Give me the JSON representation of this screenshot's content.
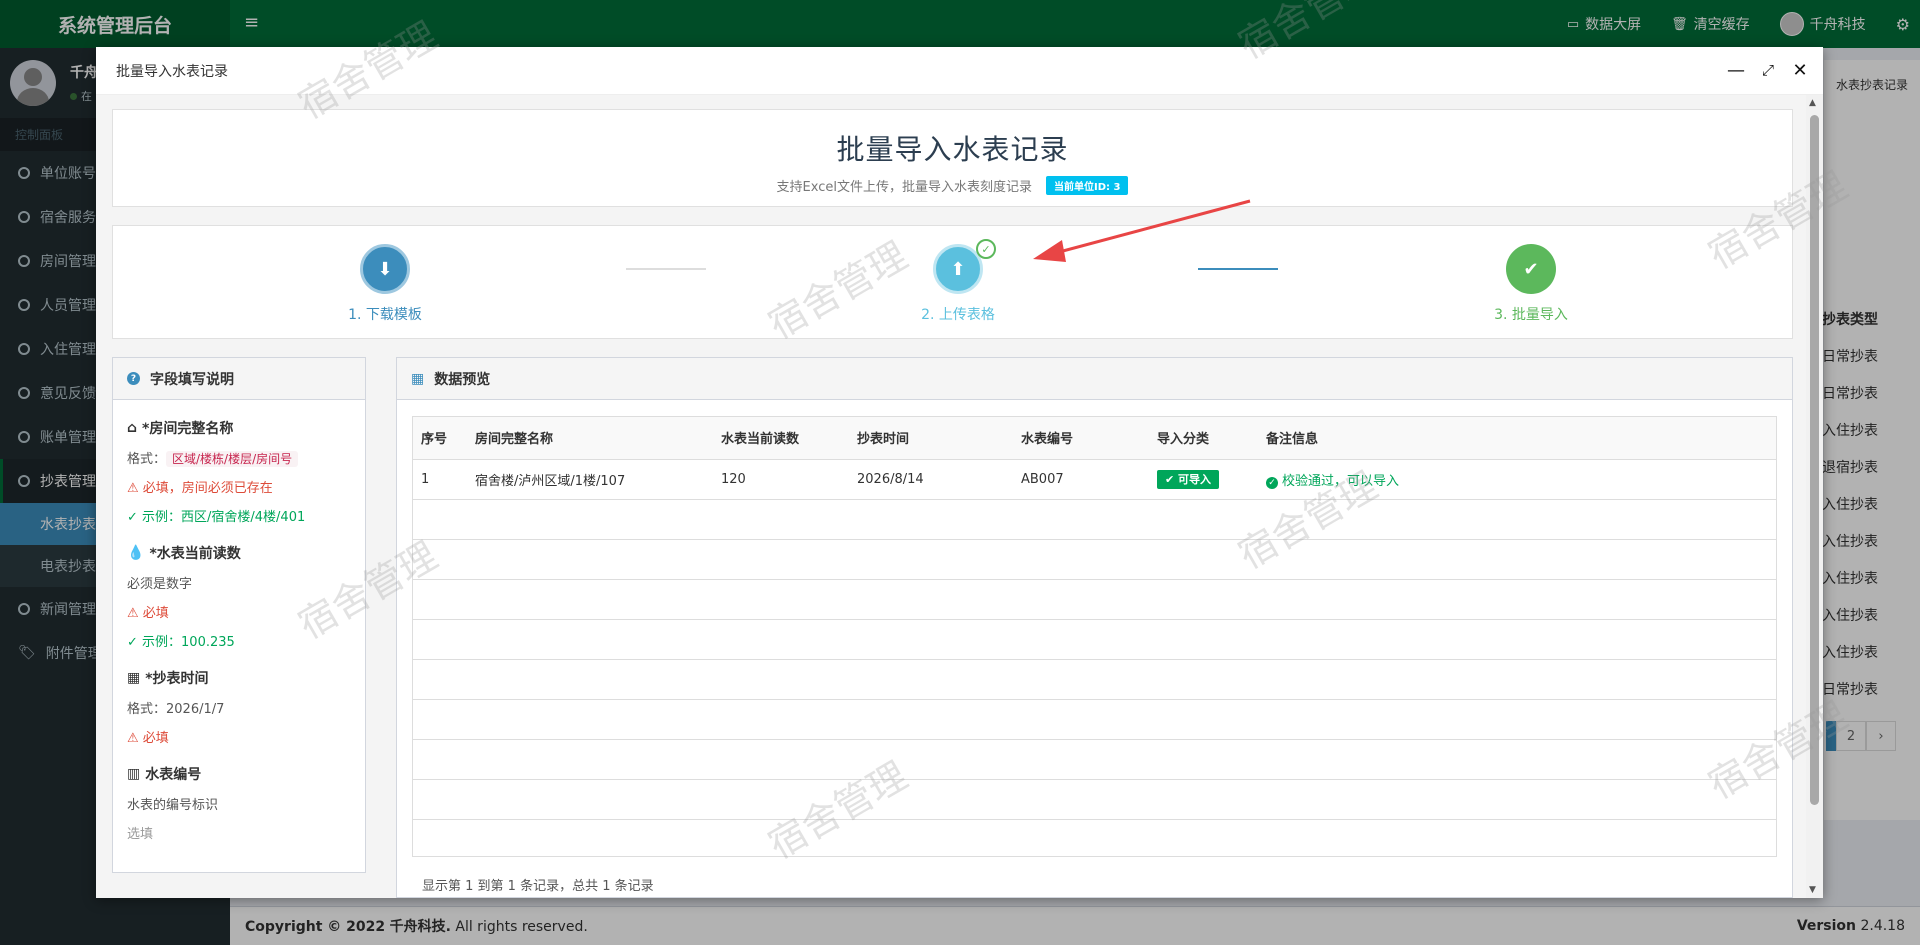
{
  "app": {
    "brand": "系统管理后台",
    "top_nav": {
      "data_screen": "数据大屏",
      "clear_cache": "清空缓存",
      "user": "千舟科技"
    },
    "user_panel": {
      "name": "千舟",
      "status": "在"
    },
    "menu_header": "控制面板",
    "menu": [
      {
        "label": "单位账号"
      },
      {
        "label": "宿舍服务"
      },
      {
        "label": "房间管理"
      },
      {
        "label": "人员管理"
      },
      {
        "label": "入住管理"
      },
      {
        "label": "意见反馈"
      },
      {
        "label": "账单管理"
      },
      {
        "label": "抄表管理"
      },
      {
        "label": "水表抄表"
      },
      {
        "label": "电表抄表"
      },
      {
        "label": "新闻管理"
      },
      {
        "label": "附件管理"
      }
    ],
    "footer": {
      "copyright_prefix": "Copyright © 2022",
      "company": "千舟科技.",
      "rights": "All rights reserved.",
      "version_label": "Version",
      "version": "2.4.18"
    },
    "bg_tab": "水表抄表记录",
    "bg_column": {
      "header": "抄表类型",
      "cells": [
        "日常抄表",
        "日常抄表",
        "入住抄表",
        "退宿抄表",
        "入住抄表",
        "入住抄表",
        "入住抄表",
        "入住抄表",
        "入住抄表",
        "日常抄表"
      ]
    },
    "bg_pager": {
      "page2": "2",
      "next": "›"
    }
  },
  "modal": {
    "title": "批量导入水表记录",
    "header": {
      "title": "批量导入水表记录",
      "subtitle": "支持Excel文件上传，批量导入水表刻度记录",
      "unit_badge": "当前单位ID: 3"
    },
    "steps": [
      {
        "label": "1. 下载模板",
        "color": "#3c8dbc"
      },
      {
        "label": "2. 上传表格",
        "color": "#5bc0de"
      },
      {
        "label": "3. 批量导入",
        "color": "#5cb85c"
      }
    ],
    "fields_panel": {
      "title": "字段填写说明",
      "fields": [
        {
          "title": "*房间完整名称",
          "format_label": "格式：",
          "format": "区域/楼栋/楼层/房间号",
          "required": "必填，房间必须已存在",
          "example": "✓ 示例：西区/宿舍楼/4楼/401"
        },
        {
          "title": "*水表当前读数",
          "desc": "必须是数字",
          "required": "必填",
          "example": "✓ 示例：100.235"
        },
        {
          "title": "*抄表时间",
          "format_text": "格式：2026/1/7",
          "required": "必填"
        },
        {
          "title": "水表编号",
          "desc": "水表的编号标识",
          "optional": "选填"
        }
      ]
    },
    "preview_panel": {
      "title": "数据预览",
      "columns": [
        "序号",
        "房间完整名称",
        "水表当前读数",
        "抄表时间",
        "水表编号",
        "导入分类",
        "备注信息"
      ],
      "rows": [
        {
          "no": "1",
          "room": "宿舍楼/泸州区域/1楼/107",
          "reading": "120",
          "time": "2026/8/14",
          "meter": "AB007",
          "category": "可导入",
          "remark": "校验通过，可以导入"
        }
      ],
      "pager_info": "显示第 1 到第 1 条记录，总共 1 条记录"
    }
  },
  "watermark": "宿舍管理"
}
